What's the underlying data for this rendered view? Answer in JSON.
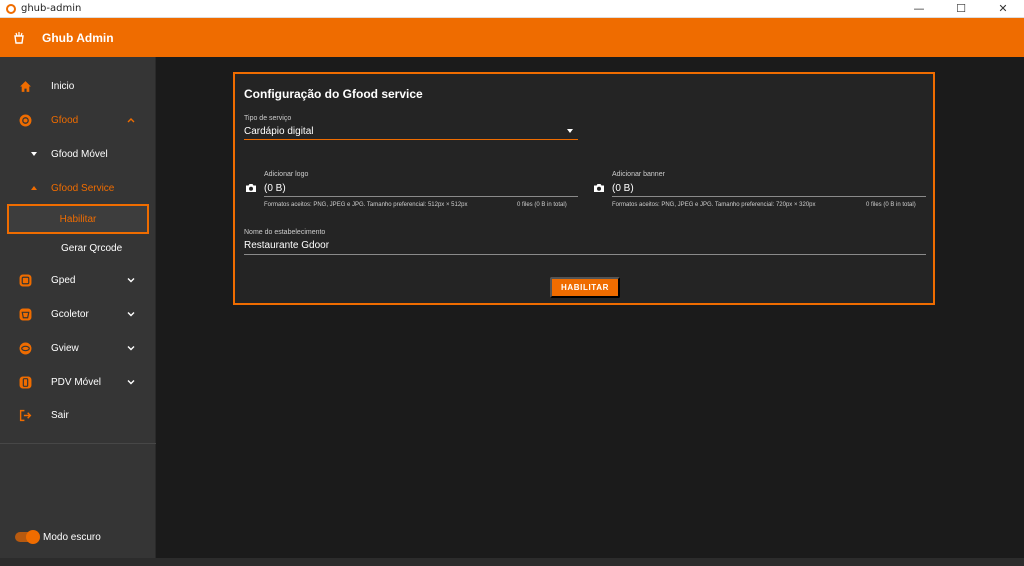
{
  "window": {
    "title": "ghub-admin",
    "controls": [
      "—",
      "☐",
      "✕"
    ]
  },
  "appbar": {
    "title": "Ghub Admin"
  },
  "sidebar": {
    "items": [
      {
        "label": "Inicio",
        "icon": "home-icon"
      },
      {
        "label": "Gfood",
        "icon": "gfood-icon"
      },
      {
        "label": "Gfood Móvel"
      },
      {
        "label": "Gfood Service"
      },
      {
        "label": "Habilitar"
      },
      {
        "label": "Gerar Qrcode"
      },
      {
        "label": "Gped",
        "icon": "gped-icon"
      },
      {
        "label": "Gcoletor",
        "icon": "gcoletor-icon"
      },
      {
        "label": "Gview",
        "icon": "gview-icon"
      },
      {
        "label": "PDV Móvel",
        "icon": "pdv-icon"
      },
      {
        "label": "Sair",
        "icon": "logout-icon"
      }
    ],
    "dark_mode_label": "Modo escuro",
    "dark_mode_on": true
  },
  "form": {
    "title": "Configuração do Gfood service",
    "service_type": {
      "label": "Tipo de serviço",
      "value": "Cardápio digital"
    },
    "logo": {
      "label": "Adicionar logo",
      "value": "(0 B)",
      "hint": "Formatos aceitos: PNG, JPEG e JPG. Tamanho preferencial: 512px × 512px",
      "count": "0 files (0 B in total)"
    },
    "banner": {
      "label": "Adicionar banner",
      "value": "(0 B)",
      "hint": "Formatos aceitos: PNG, JPEG e JPG. Tamanho preferencial: 720px × 320px",
      "count": "0 files (0 B in total)"
    },
    "establishment": {
      "label": "Nome do estabelecimento",
      "value": "Restaurante Gdoor"
    },
    "submit_label": "HABILITAR"
  },
  "colors": {
    "accent": "#ef6c00",
    "sidebar": "#353535",
    "background": "#1b1b1b",
    "card": "#242424"
  }
}
